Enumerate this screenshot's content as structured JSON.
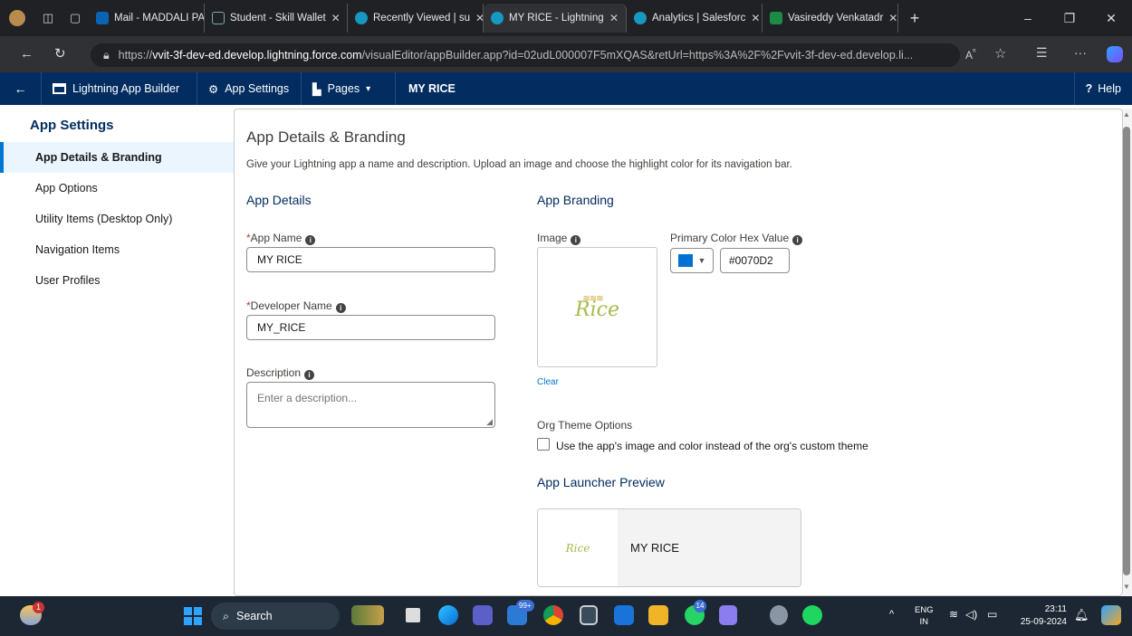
{
  "browser": {
    "tabs": [
      {
        "label": "Mail - MADDALI PA/"
      },
      {
        "label": "Student - Skill Wallet"
      },
      {
        "label": "Recently Viewed | su"
      },
      {
        "label": "MY RICE - Lightning"
      },
      {
        "label": "Analytics | Salesforc"
      },
      {
        "label": "Vasireddy Venkatadr"
      }
    ],
    "url_prefix": "https://",
    "url_host": "vvit-3f-dev-ed.develop.lightning.force.com",
    "url_path": "/visualEditor/appBuilder.app?id=02udL000007F5mXQAS&retUrl=https%3A%2F%2Fvvit-3f-dev-ed.develop.li...",
    "read_aloud": "A̅"
  },
  "header": {
    "back_icon": "←",
    "builder_label": "Lightning App Builder",
    "settings_label": "App Settings",
    "pages_label": "Pages",
    "app_name": "MY RICE",
    "help_label": "Help"
  },
  "sidebar": {
    "title": "App Settings",
    "items": [
      {
        "label": "App Details & Branding"
      },
      {
        "label": "App Options"
      },
      {
        "label": "Utility Items (Desktop Only)"
      },
      {
        "label": "Navigation Items"
      },
      {
        "label": "User Profiles"
      }
    ]
  },
  "main": {
    "title": "App Details & Branding",
    "description": "Give your Lightning app a name and description. Upload an image and choose the highlight color for its navigation bar.",
    "details_heading": "App Details",
    "app_name_label": "App Name",
    "app_name_value": "MY RICE",
    "dev_name_label": "Developer Name",
    "dev_name_value": "MY_RICE",
    "desc_label": "Description",
    "desc_placeholder": "Enter a description...",
    "branding_heading": "App Branding",
    "image_label": "Image",
    "logo_text": "Rice",
    "clear_label": "Clear",
    "color_label": "Primary Color Hex Value",
    "color_value": "#0070D2",
    "org_theme_label": "Org Theme Options",
    "org_theme_checkbox": "Use the app's image and color instead of the org's custom theme",
    "preview_heading": "App Launcher Preview",
    "preview_name": "MY RICE"
  },
  "colors": {
    "header_bg": "#032d60",
    "primary": "#0070D2",
    "accent": "#0176d3"
  },
  "taskbar": {
    "search_label": "Search",
    "badge_store": "99+",
    "badge_whatsapp": "14",
    "weather_badge": "1",
    "lang": "ENG",
    "region": "IN",
    "time": "23:11",
    "date": "25-09-2024"
  }
}
